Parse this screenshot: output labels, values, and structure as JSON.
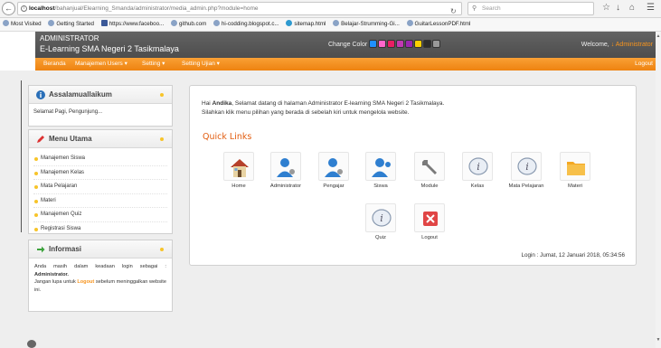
{
  "browser": {
    "url_host": "localhost",
    "url_path": "/bahanjual/Elearning_Smanda/administrator/media_admin.php?module=home",
    "search_placeholder": "Search",
    "bookmarks": [
      {
        "label": "Most Visited",
        "icon": "bookmark-icon"
      },
      {
        "label": "Getting Started",
        "icon": "firefox-icon"
      },
      {
        "label": "https://www.faceboo...",
        "icon": "facebook-icon"
      },
      {
        "label": "github.com",
        "icon": "globe-icon"
      },
      {
        "label": "hi-codding.blogspot.c...",
        "icon": "globe-icon"
      },
      {
        "label": "sitemap.html",
        "icon": "globe-icon"
      },
      {
        "label": "Belajar-Strumming-Gi...",
        "icon": "globe-icon"
      },
      {
        "label": "GuitarLessonPDF.html",
        "icon": "globe-icon"
      }
    ]
  },
  "header": {
    "title_line1": "ADMINISTRATOR",
    "title_line2": "E-Learning SMA Negeri 2 Tasikmalaya",
    "change_color_label": "Change Color",
    "swatches": [
      "#1e90ff",
      "#ff66cc",
      "#e91e63",
      "#c239b3",
      "#9c27b0",
      "#fbd000",
      "#2d2d2d",
      "#999999"
    ],
    "welcome_prefix": "Welcome,",
    "welcome_user": "Administrator"
  },
  "menubar": {
    "items": [
      "Beranda",
      "Manajemen Users",
      "Setting",
      "Setting Ujian"
    ],
    "logout": "Logout",
    "active_bg": "#f7941d"
  },
  "sidebar": {
    "greeting_box": {
      "title": "Assalamuallaikum",
      "text": "Selamat Pagi, Pengunjung..."
    },
    "menu_box": {
      "title": "Menu Utama",
      "items": [
        "Manajemen Siswa",
        "Manajemen Kelas",
        "Mata Pelajaran",
        "Materi",
        "Manajemen Quiz",
        "Registrasi Siswa"
      ]
    },
    "info_box": {
      "title": "Informasi",
      "line1": "Anda masih dalam keadaan login sebagai :",
      "role": "Administrator.",
      "line2_prefix": "Jangan lupa untuk",
      "logout_word": "Logout",
      "line2_suffix": "sebelum meninggalkan website ini."
    }
  },
  "main": {
    "greet_prefix": "Hai",
    "greet_name": "Andika",
    "greet_rest": ", Selamat datang di halaman Administrator E-learning SMA Negeri 2 Tasikmalaya.",
    "greet_line2": "Silahkan klik menu pilihan yang berada di sebelah kiri untuk mengelola website.",
    "quick_links_title": "Quick Links",
    "quick_links": [
      {
        "label": "Home",
        "icon": "house-icon"
      },
      {
        "label": "Administrator",
        "icon": "user-icon"
      },
      {
        "label": "Pengajar",
        "icon": "user-icon"
      },
      {
        "label": "Siswa",
        "icon": "user-icon"
      },
      {
        "label": "Module",
        "icon": "wrench-icon"
      },
      {
        "label": "Kelas",
        "icon": "info-icon"
      },
      {
        "label": "Mata Pelajaran",
        "icon": "info-icon"
      },
      {
        "label": "Materi",
        "icon": "folder-icon"
      },
      {
        "label": "Quiz",
        "icon": "info-icon"
      },
      {
        "label": "Logout",
        "icon": "close-icon"
      }
    ],
    "login_time": "Login : Jumat, 12 Januari 2018, 05:34:56"
  }
}
